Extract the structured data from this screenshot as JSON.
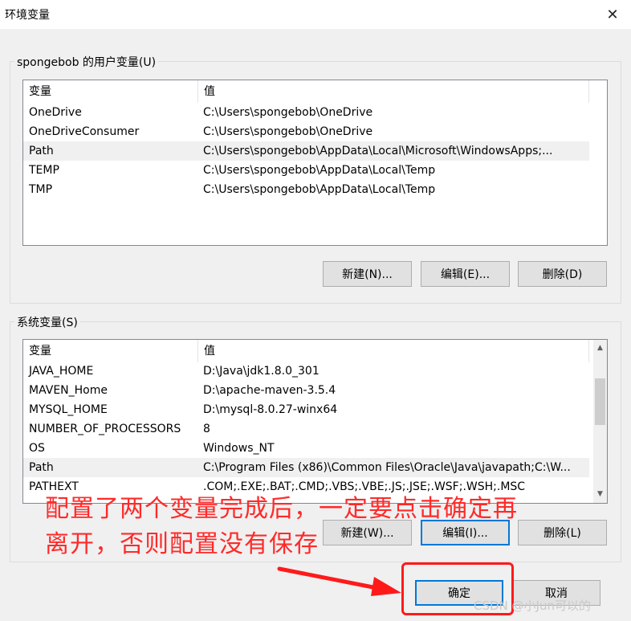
{
  "window": {
    "title": "环境变量",
    "close_glyph": "✕"
  },
  "user_vars": {
    "label": "spongebob 的用户变量(U)",
    "columns": [
      "变量",
      "值"
    ],
    "rows": [
      {
        "name": "OneDrive",
        "value": "C:\\Users\\spongebob\\OneDrive"
      },
      {
        "name": "OneDriveConsumer",
        "value": "C:\\Users\\spongebob\\OneDrive"
      },
      {
        "name": "Path",
        "value": "C:\\Users\\spongebob\\AppData\\Local\\Microsoft\\WindowsApps;..."
      },
      {
        "name": "TEMP",
        "value": "C:\\Users\\spongebob\\AppData\\Local\\Temp"
      },
      {
        "name": "TMP",
        "value": "C:\\Users\\spongebob\\AppData\\Local\\Temp"
      }
    ],
    "buttons": {
      "new": "新建(N)...",
      "edit": "编辑(E)...",
      "delete": "删除(D)"
    }
  },
  "system_vars": {
    "label": "系统变量(S)",
    "columns": [
      "变量",
      "值"
    ],
    "rows": [
      {
        "name": "JAVA_HOME",
        "value": "D:\\Java\\jdk1.8.0_301"
      },
      {
        "name": "MAVEN_Home",
        "value": "D:\\apache-maven-3.5.4"
      },
      {
        "name": "MYSQL_HOME",
        "value": "D:\\mysql-8.0.27-winx64"
      },
      {
        "name": "NUMBER_OF_PROCESSORS",
        "value": "8"
      },
      {
        "name": "OS",
        "value": "Windows_NT"
      },
      {
        "name": "Path",
        "value": "C:\\Program Files (x86)\\Common Files\\Oracle\\Java\\javapath;C:\\W..."
      },
      {
        "name": "PATHEXT",
        "value": ".COM;.EXE;.BAT;.CMD;.VBS;.VBE;.JS;.JSE;.WSF;.WSH;.MSC"
      }
    ],
    "buttons": {
      "new": "新建(W)...",
      "edit": "编辑(I)...",
      "delete": "删除(L)"
    }
  },
  "footer": {
    "ok": "确定",
    "cancel": "取消"
  },
  "annotation": {
    "line1": "配置了两个变量完成后，一定要点击确定再",
    "line2": "离开，否则配置没有保存"
  },
  "watermark": "CSDN @小Jun可以的",
  "colors": {
    "annotation": "#ff2a2a",
    "focus": "#0078d7",
    "selected_row": "#f0f0f0"
  },
  "icons": {
    "close": "close-icon",
    "scroll_up": "chevron-up-icon",
    "scroll_down": "chevron-down-icon"
  }
}
